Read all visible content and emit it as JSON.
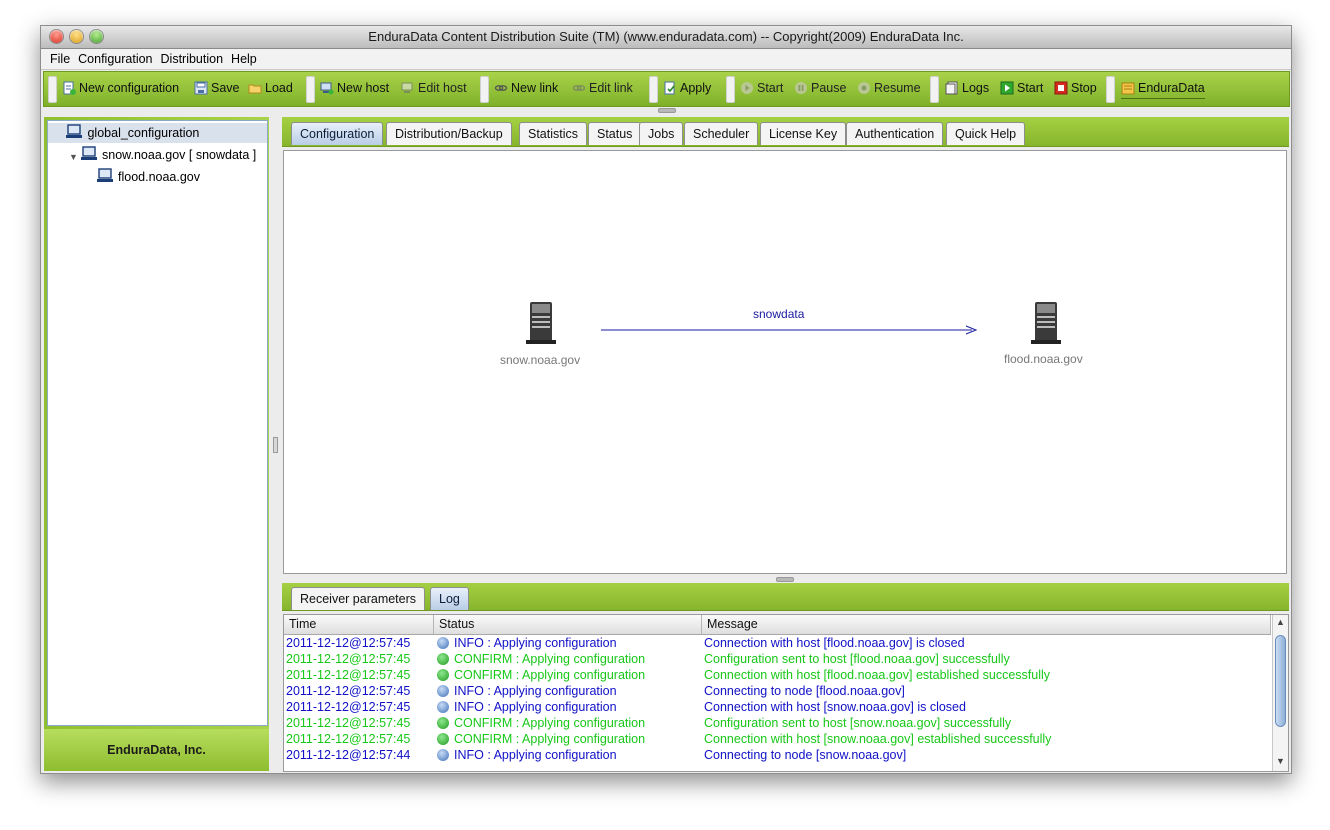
{
  "window": {
    "title": "EnduraData Content Distribution Suite (TM) (www.enduradata.com) -- Copyright(2009) EnduraData Inc."
  },
  "menu": [
    "File",
    "Configuration",
    "Distribution",
    "Help"
  ],
  "toolbar": {
    "new_configuration": "New configuration",
    "save": "Save",
    "load": "Load",
    "new_host": "New host",
    "edit_host": "Edit host",
    "new_link": "New link",
    "edit_link": "Edit link",
    "apply": "Apply",
    "start1": "Start",
    "pause": "Pause",
    "resume": "Resume",
    "logs": "Logs",
    "start2": "Start",
    "stop": "Stop",
    "enduradata": "EnduraData"
  },
  "tree": {
    "root": "global_configuration",
    "host": "snow.noaa.gov [ snowdata ]",
    "child": "flood.noaa.gov"
  },
  "footer": {
    "company": "EnduraData, Inc."
  },
  "tabs": [
    "Configuration",
    "Distribution/Backup",
    "Statistics",
    "Status",
    "Jobs",
    "Scheduler",
    "License Key",
    "Authentication",
    "Quick Help"
  ],
  "active_tab": "Configuration",
  "diagram": {
    "source_label": "snow.noaa.gov",
    "target_label": "flood.noaa.gov",
    "link_label": "snowdata"
  },
  "bottom_tabs": [
    "Receiver parameters",
    "Log"
  ],
  "log": {
    "columns": [
      "Time",
      "Status",
      "Message"
    ],
    "rows": [
      {
        "time": "2011-12-12@12:57:45",
        "type": "info",
        "status": "INFO : Applying configuration",
        "message": "Connection with host [flood.noaa.gov] is closed"
      },
      {
        "time": "2011-12-12@12:57:45",
        "type": "confirm",
        "status": "CONFIRM : Applying configuration",
        "message": "Configuration sent to host [flood.noaa.gov] successfully"
      },
      {
        "time": "2011-12-12@12:57:45",
        "type": "confirm",
        "status": "CONFIRM : Applying configuration",
        "message": "Connection with host [flood.noaa.gov] established successfully"
      },
      {
        "time": "2011-12-12@12:57:45",
        "type": "info",
        "status": "INFO : Applying configuration",
        "message": "Connecting to node [flood.noaa.gov]"
      },
      {
        "time": "2011-12-12@12:57:45",
        "type": "info",
        "status": "INFO : Applying configuration",
        "message": "Connection with host [snow.noaa.gov] is closed"
      },
      {
        "time": "2011-12-12@12:57:45",
        "type": "confirm",
        "status": "CONFIRM : Applying configuration",
        "message": "Configuration sent to host [snow.noaa.gov] successfully"
      },
      {
        "time": "2011-12-12@12:57:45",
        "type": "confirm",
        "status": "CONFIRM : Applying configuration",
        "message": "Connection with host [snow.noaa.gov] established successfully"
      },
      {
        "time": "2011-12-12@12:57:44",
        "type": "info",
        "status": "INFO : Applying configuration",
        "message": "Connecting to node [snow.noaa.gov]"
      }
    ]
  },
  "colors": {
    "info": "#1010c8",
    "confirm": "#18c818",
    "accent_green": "#9ccc3c",
    "active_tab": "#b9cde6"
  }
}
